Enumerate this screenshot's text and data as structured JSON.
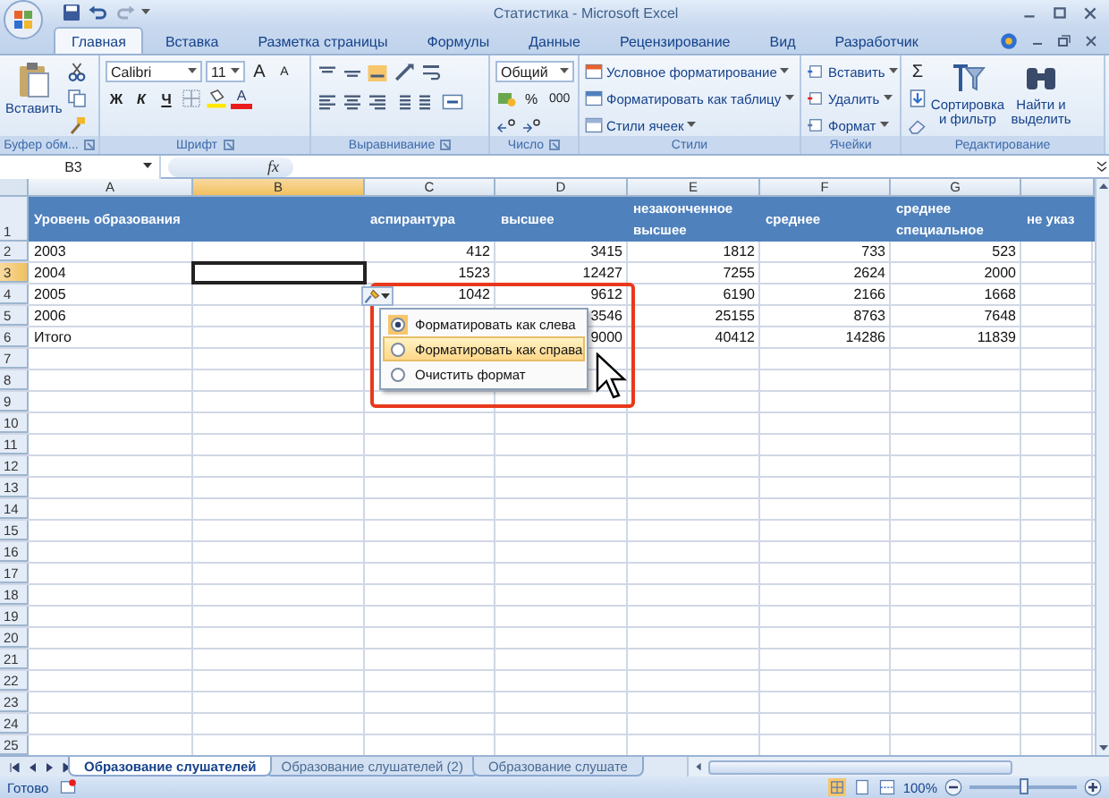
{
  "window": {
    "title": "Статистика - Microsoft Excel"
  },
  "ribbon_tabs": [
    {
      "label": "Главная",
      "selected": true
    },
    {
      "label": "Вставка",
      "selected": false
    },
    {
      "label": "Разметка страницы",
      "selected": false
    },
    {
      "label": "Формулы",
      "selected": false
    },
    {
      "label": "Данные",
      "selected": false
    },
    {
      "label": "Рецензирование",
      "selected": false
    },
    {
      "label": "Вид",
      "selected": false
    },
    {
      "label": "Разработчик",
      "selected": false
    }
  ],
  "clipboard": {
    "paste": "Вставить",
    "label": "Буфер обм..."
  },
  "font": {
    "name": "Calibri",
    "size": "11",
    "grow": "A",
    "shrink": "A",
    "bold": "Ж",
    "italic": "К",
    "underline": "Ч",
    "color_letter": "A",
    "label": "Шрифт"
  },
  "alignment": {
    "label": "Выравнивание"
  },
  "number": {
    "format": "Общий",
    "percent": "%",
    "thousands": "000",
    "label": "Число"
  },
  "styles": {
    "items": [
      "Условное форматирование",
      "Форматировать как таблицу",
      "Стили ячеек"
    ],
    "label": "Стили"
  },
  "cells": {
    "items": [
      "Вставить",
      "Удалить",
      "Формат"
    ],
    "label": "Ячейки"
  },
  "editing": {
    "sum": "Σ",
    "sort": "Сортировка и фильтр",
    "find": "Найти и выделить",
    "label": "Редактирование"
  },
  "formula_bar": {
    "name_box": "B3",
    "fx": "fx"
  },
  "sheet": {
    "columns": [
      {
        "letter": "A",
        "selected": false
      },
      {
        "letter": "B",
        "selected": true
      },
      {
        "letter": "C",
        "selected": false
      },
      {
        "letter": "D",
        "selected": false
      },
      {
        "letter": "E",
        "selected": false
      },
      {
        "letter": "F",
        "selected": false
      },
      {
        "letter": "G",
        "selected": false
      }
    ],
    "header_row": {
      "number": "1",
      "cells": [
        "Уровень образования",
        null,
        "аспирантура",
        "высшее",
        "незаконченное высшее",
        "среднее",
        "среднее специальное",
        "не указ"
      ]
    },
    "rows": [
      {
        "number": "2",
        "selected": false,
        "cells": [
          "2003",
          null,
          "412",
          "3415",
          "1812",
          "733",
          "523"
        ]
      },
      {
        "number": "3",
        "selected": true,
        "cells": [
          "2004",
          null,
          "1523",
          "12427",
          "7255",
          "2624",
          "2000"
        ]
      },
      {
        "number": "4",
        "selected": false,
        "cells": [
          "2005",
          null,
          "1042",
          "9612",
          "6190",
          "2166",
          "1668"
        ]
      },
      {
        "number": "5",
        "selected": false,
        "cells": [
          "2006",
          null,
          null,
          "3546",
          "25155",
          "8763",
          "7648"
        ]
      },
      {
        "number": "6",
        "selected": false,
        "cells": [
          "Итого",
          null,
          null,
          "9000",
          "40412",
          "14286",
          "11839"
        ]
      },
      {
        "number": "7",
        "selected": false,
        "cells": []
      },
      {
        "number": "8",
        "selected": false,
        "cells": []
      },
      {
        "number": "9",
        "selected": false,
        "cells": []
      },
      {
        "number": "10",
        "selected": false,
        "cells": []
      },
      {
        "number": "11",
        "selected": false,
        "cells": []
      },
      {
        "number": "12",
        "selected": false,
        "cells": []
      },
      {
        "number": "13",
        "selected": false,
        "cells": []
      },
      {
        "number": "14",
        "selected": false,
        "cells": []
      },
      {
        "number": "15",
        "selected": false,
        "cells": []
      },
      {
        "number": "16",
        "selected": false,
        "cells": []
      },
      {
        "number": "17",
        "selected": false,
        "cells": []
      },
      {
        "number": "18",
        "selected": false,
        "cells": []
      },
      {
        "number": "19",
        "selected": false,
        "cells": []
      },
      {
        "number": "20",
        "selected": false,
        "cells": []
      },
      {
        "number": "21",
        "selected": false,
        "cells": []
      },
      {
        "number": "22",
        "selected": false,
        "cells": []
      },
      {
        "number": "23",
        "selected": false,
        "cells": []
      },
      {
        "number": "24",
        "selected": false,
        "cells": []
      },
      {
        "number": "25",
        "selected": false,
        "cells": []
      }
    ]
  },
  "paste_options_menu": [
    {
      "label": "Форматировать как слева",
      "selected": true,
      "hovered": false
    },
    {
      "label": "Форматировать как справа",
      "selected": false,
      "hovered": true
    },
    {
      "label": "Очистить формат",
      "selected": false,
      "hovered": false
    }
  ],
  "sheet_tabs": [
    {
      "label": "Образование слушателей",
      "selected": true
    },
    {
      "label": "Образование слушателей (2)",
      "selected": false
    },
    {
      "label": "Образование слушате",
      "selected": false
    }
  ],
  "status_bar": {
    "status": "Готово",
    "zoom": "100%",
    "zoom_level": {
      "level": 0.5
    }
  }
}
